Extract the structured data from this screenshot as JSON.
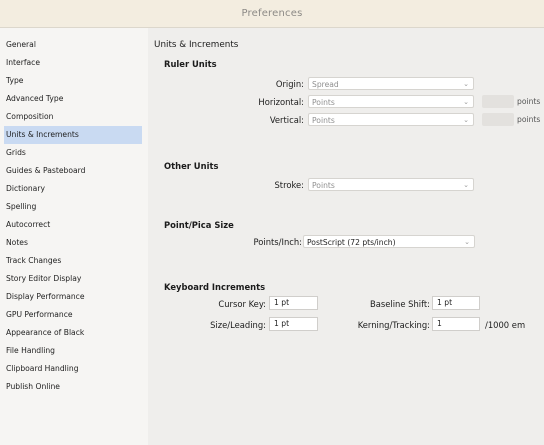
{
  "window": {
    "title": "Preferences"
  },
  "sidebar": {
    "items": [
      {
        "label": "General"
      },
      {
        "label": "Interface"
      },
      {
        "label": "Type"
      },
      {
        "label": "Advanced Type"
      },
      {
        "label": "Composition"
      },
      {
        "label": "Units & Increments",
        "selected": true
      },
      {
        "label": "Grids"
      },
      {
        "label": "Guides & Pasteboard"
      },
      {
        "label": "Dictionary"
      },
      {
        "label": "Spelling"
      },
      {
        "label": "Autocorrect"
      },
      {
        "label": "Notes"
      },
      {
        "label": "Track Changes"
      },
      {
        "label": "Story Editor Display"
      },
      {
        "label": "Display Performance"
      },
      {
        "label": "GPU Performance"
      },
      {
        "label": "Appearance of Black"
      },
      {
        "label": "File Handling"
      },
      {
        "label": "Clipboard Handling"
      },
      {
        "label": "Publish Online"
      }
    ]
  },
  "panel": {
    "title": "Units & Increments",
    "ruler": {
      "heading": "Ruler Units",
      "origin_label": "Origin:",
      "origin_value": "Spread",
      "horizontal_label": "Horizontal:",
      "horizontal_value": "Points",
      "horizontal_unit": "points",
      "vertical_label": "Vertical:",
      "vertical_value": "Points",
      "vertical_unit": "points"
    },
    "other": {
      "heading": "Other Units",
      "stroke_label": "Stroke:",
      "stroke_value": "Points"
    },
    "pica": {
      "heading": "Point/Pica Size",
      "points_label": "Points/Inch:",
      "points_value": "PostScript (72 pts/inch)"
    },
    "keyboard": {
      "heading": "Keyboard Increments",
      "cursor_label": "Cursor Key:",
      "cursor_value": "1 pt",
      "size_label": "Size/Leading:",
      "size_value": "1 pt",
      "baseline_label": "Baseline Shift:",
      "baseline_value": "1 pt",
      "kerning_label": "Kerning/Tracking:",
      "kerning_value": "1",
      "kerning_unit": "/1000 em"
    }
  }
}
